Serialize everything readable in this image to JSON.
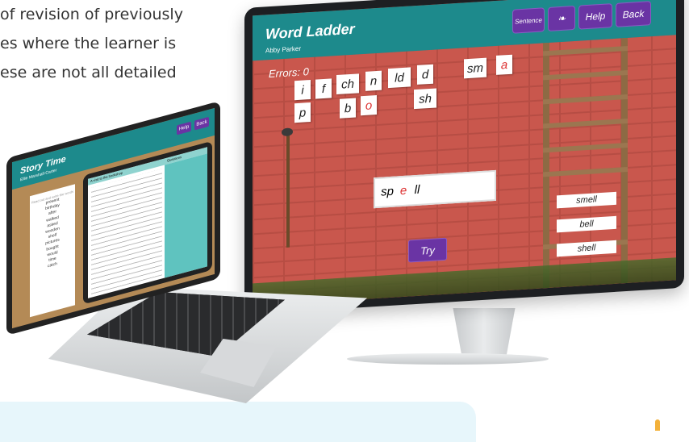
{
  "intro_text": {
    "line1": "of revision of previously",
    "line2": "es where the learner is",
    "line3": "ese are not all detailed"
  },
  "monitor_app": {
    "title": "Word Ladder",
    "user": "Abby Parker",
    "buttons": {
      "sentence": "Sentence",
      "help": "Help",
      "back": "Back"
    },
    "errors_label": "Errors: 0",
    "letter_tiles": [
      {
        "text": "i"
      },
      {
        "text": "f"
      },
      {
        "text": "ch"
      },
      {
        "text": "n"
      },
      {
        "text": "ld"
      },
      {
        "text": "d"
      },
      {
        "text": "sm"
      },
      {
        "text": "a",
        "color": "#dd3333"
      },
      {
        "text": "p"
      },
      {
        "text": "b"
      },
      {
        "text": "o",
        "color": "#dd3333"
      },
      {
        "text": "sh"
      }
    ],
    "answer": {
      "part1": "sp",
      "part2": "e",
      "part3": "ll"
    },
    "try_button": "Try",
    "ladder_words": [
      "smell",
      "bell",
      "shell"
    ]
  },
  "laptop_app": {
    "title": "Story Time",
    "user": "Ellie Marshall-Carter",
    "buttons": {
      "help": "Help",
      "back": "Back"
    },
    "notebook_heading": "Read out and write the words",
    "notebook_words": [
      "present",
      "birthday",
      "after",
      "walked",
      "asked",
      "wooden",
      "shelf",
      "pictures",
      "bought",
      "would",
      "time",
      "catch"
    ],
    "story_heading": "A visit to the bookshop",
    "questions_heading": "Questions"
  },
  "colors": {
    "teal_bar": "#1d8a8c",
    "purple_button": "#6a34a4",
    "brick": "#c9574d"
  }
}
